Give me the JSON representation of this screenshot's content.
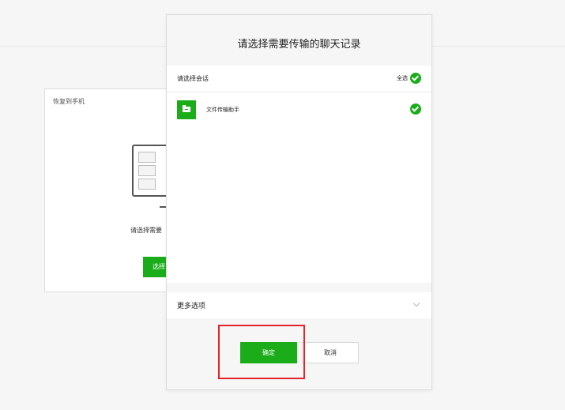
{
  "background_card": {
    "title": "恢复到手机",
    "hint": "请选择需要",
    "select_button": "选择"
  },
  "dialog": {
    "title": "请选择需要传输的聊天记录",
    "list_header": "请选择会话",
    "select_all": "全选",
    "chats": [
      {
        "name": "文件传输助手",
        "icon": "folder-icon",
        "checked": true
      }
    ],
    "more_options": "更多选项",
    "confirm_button": "确定",
    "cancel_button": "取消"
  },
  "colors": {
    "accent": "#1aad19",
    "highlight_box": "#e3242b"
  }
}
